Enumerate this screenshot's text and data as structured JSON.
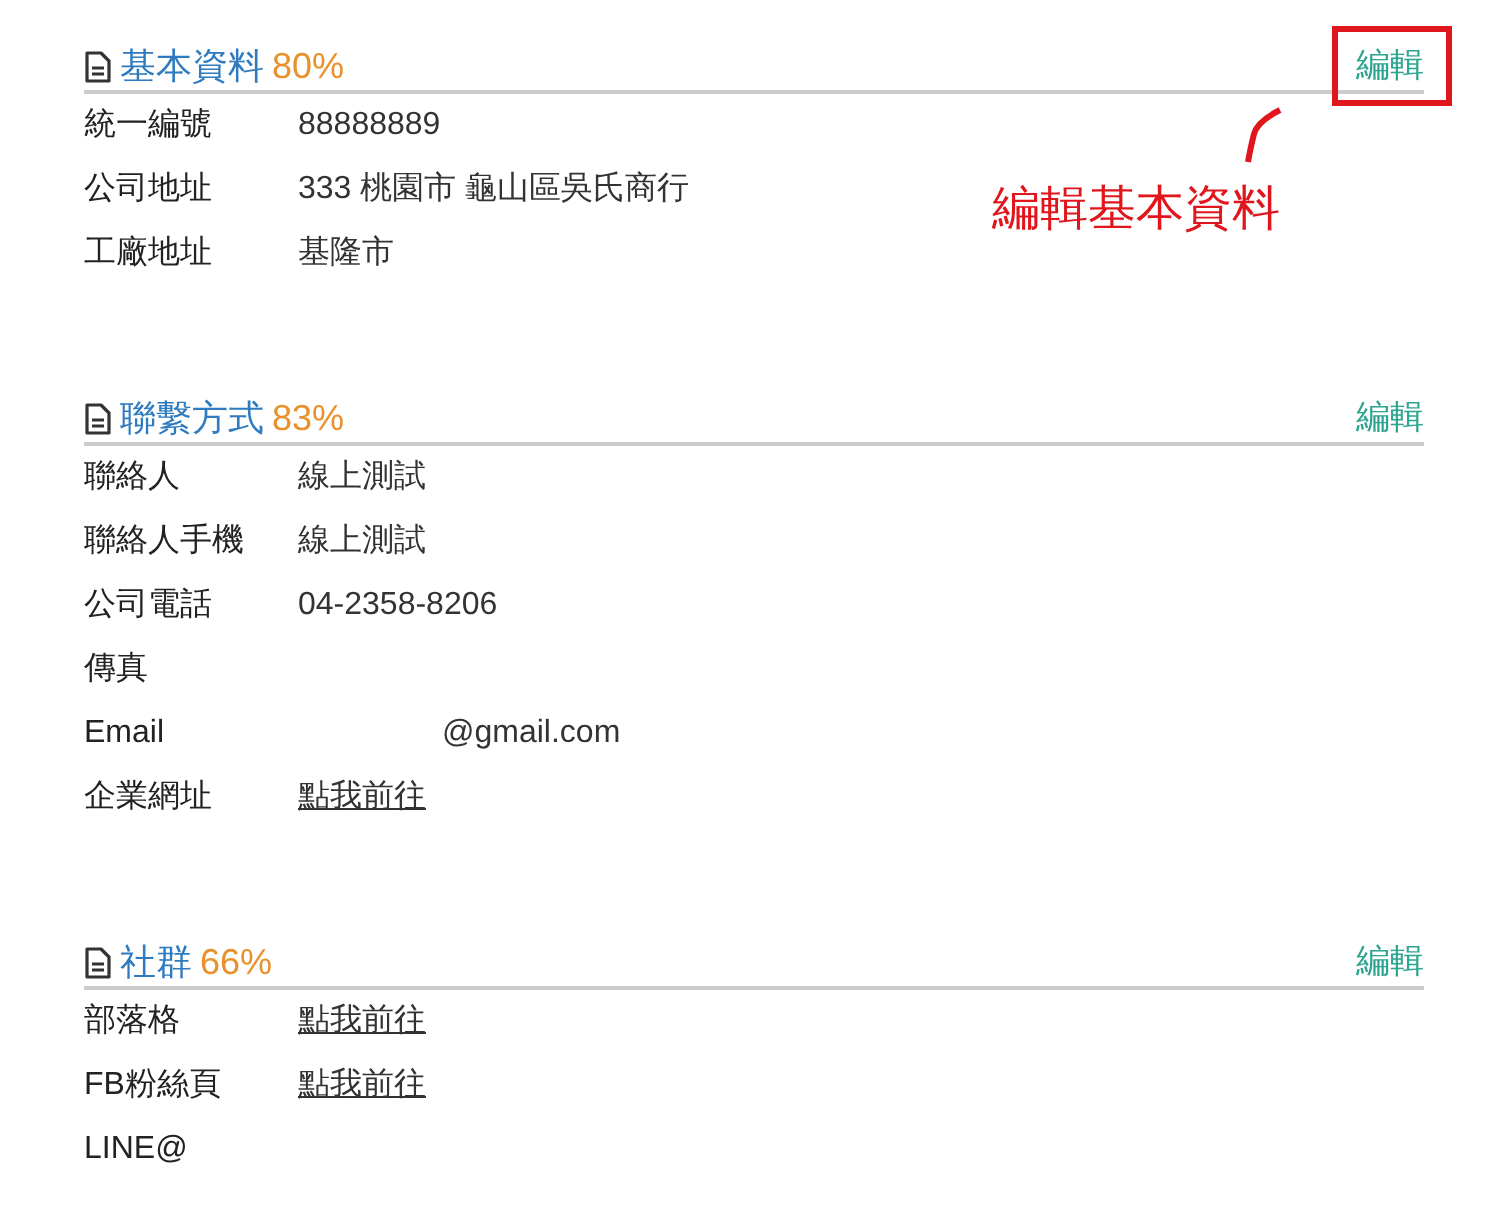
{
  "sections": [
    {
      "title": "基本資料",
      "percent": "80%",
      "edit": "編輯",
      "edit_highlighted": true,
      "rows": [
        {
          "label": "統一編號",
          "value": "88888889",
          "kind": "text"
        },
        {
          "label": "公司地址",
          "value": "333 桃園市 龜山區吳氏商行",
          "kind": "text"
        },
        {
          "label": "工廠地址",
          "value": "基隆市",
          "kind": "text"
        }
      ]
    },
    {
      "title": "聯繫方式",
      "percent": "83%",
      "edit": "編輯",
      "edit_highlighted": false,
      "rows": [
        {
          "label": "聯絡人",
          "value": "線上測試",
          "kind": "text"
        },
        {
          "label": "聯絡人手機",
          "value": "線上測試",
          "kind": "text"
        },
        {
          "label": "公司電話",
          "value": "04-2358-8206",
          "kind": "text"
        },
        {
          "label": "傳真"
        },
        {
          "label": "Email",
          "value": "@gmail.com",
          "kind": "redacted"
        },
        {
          "label": "企業網址",
          "value": "點我前往",
          "kind": "link"
        }
      ]
    },
    {
      "title": "社群",
      "percent": "66%",
      "edit": "編輯",
      "edit_highlighted": false,
      "rows": [
        {
          "label": "部落格",
          "value": "點我前往",
          "kind": "link"
        },
        {
          "label": "FB粉絲頁",
          "value": "點我前往",
          "kind": "link"
        },
        {
          "label": "LINE@"
        }
      ]
    }
  ],
  "annotation": {
    "text": "編輯基本資料"
  }
}
